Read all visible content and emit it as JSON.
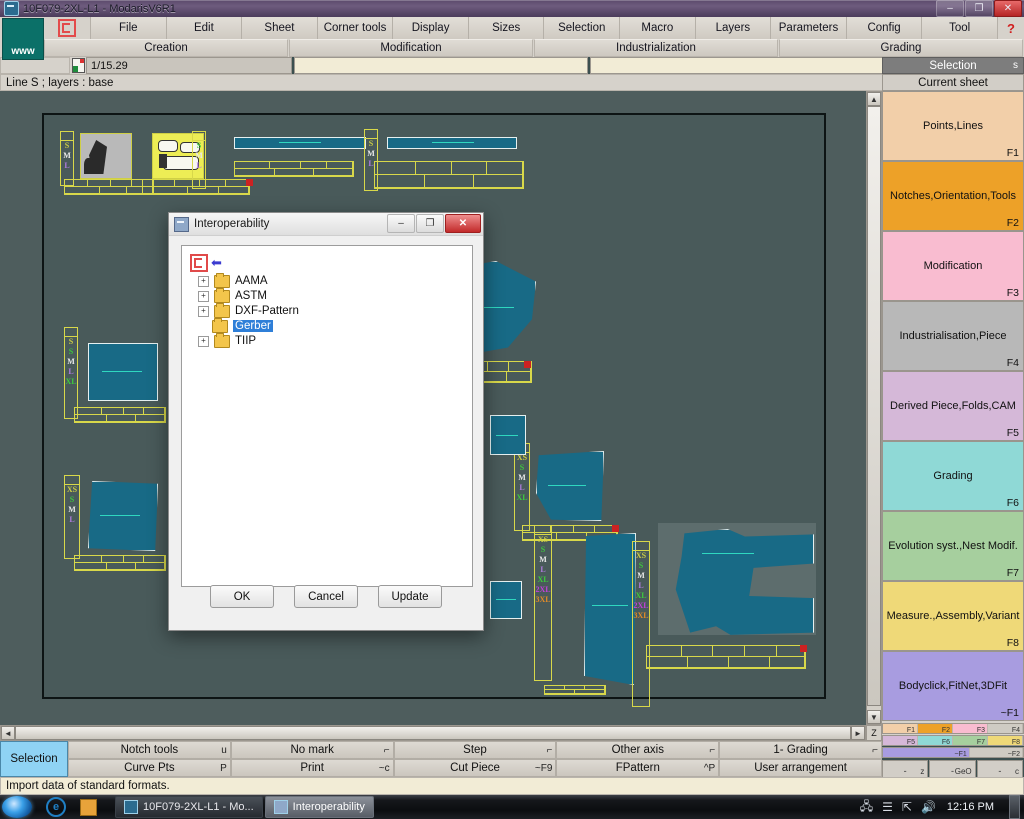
{
  "window": {
    "title": "10F079-2XL-L1 - ModarisV6R1",
    "minimize": "–",
    "maximize": "❐",
    "close": "✕"
  },
  "menubar": {
    "logo_icon": "modaris-logo-icon",
    "www_label": "www",
    "items": [
      "File",
      "Edit",
      "Sheet",
      "Corner tools",
      "Display",
      "Sizes",
      "Selection",
      "Macro",
      "Layers",
      "Parameters",
      "Config",
      "Tool"
    ],
    "help_label": "?"
  },
  "submenubar": {
    "items": [
      "Creation",
      "Modification",
      "Industrialization",
      "Grading"
    ]
  },
  "fieldrow": {
    "sheet_icon": "sheet-icon",
    "scale_value": "1/15.29",
    "input2_value": "",
    "input3_value": "",
    "selection_label": "Selection",
    "selection_key": "s"
  },
  "layerline": {
    "text": "Line S   ;   layers : base",
    "current_sheet": "Current sheet"
  },
  "right_panel": {
    "fkeys": [
      {
        "label": "Points,Lines",
        "key": "F1",
        "color": "#f2cfa9"
      },
      {
        "label": "Notches,Orientation,Tools",
        "key": "F2",
        "color": "#eda128"
      },
      {
        "label": "Modification",
        "key": "F3",
        "color": "#f9bcd0"
      },
      {
        "label": "Industrialisation,Piece",
        "key": "F4",
        "color": "#b8b8b8"
      },
      {
        "label": "Derived Piece,Folds,CAM",
        "key": "F5",
        "color": "#d5b8d8"
      },
      {
        "label": "Grading",
        "key": "F6",
        "color": "#8fd9d6"
      },
      {
        "label": "Evolution syst.,Nest Modif.",
        "key": "F7",
        "color": "#a6cf9e"
      },
      {
        "label": "Measure.,Assembly,Variant",
        "key": "F8",
        "color": "#efd978"
      },
      {
        "label": "Bodyclick,FitNet,3DFit",
        "key": "~F1",
        "color": "#a89ce0"
      }
    ],
    "legend_row1": [
      {
        "key": "F1",
        "color": "#f2cfa9"
      },
      {
        "key": "F2",
        "color": "#eda128"
      },
      {
        "key": "F3",
        "color": "#f9bcd0"
      },
      {
        "key": "F4",
        "color": "#cfcbc3"
      }
    ],
    "legend_row2": [
      {
        "key": "F5",
        "color": "#d5b8d8"
      },
      {
        "key": "F6",
        "color": "#8fd9d6"
      },
      {
        "key": "F7",
        "color": "#a6cf9e"
      },
      {
        "key": "F8",
        "color": "#efd978"
      }
    ],
    "legend_row3": [
      {
        "key": "~F1",
        "color": "#a89ce0"
      },
      {
        "key": "~F2",
        "color": "#cfcbc3"
      }
    ],
    "bottom_cells": [
      {
        "label": "-",
        "accel": "z"
      },
      {
        "label": "-",
        "accel": "GeO"
      },
      {
        "label": "-",
        "accel": "c"
      }
    ]
  },
  "bottom_toolbar": {
    "selection_label": "Selection",
    "row1": [
      {
        "label": "Notch tools",
        "accel": "u"
      },
      {
        "label": "No mark",
        "accel": "⌐"
      },
      {
        "label": "Step",
        "accel": "⌐"
      },
      {
        "label": "Other axis",
        "accel": "⌐"
      },
      {
        "label": "1- Grading",
        "accel": "⌐"
      }
    ],
    "row2": [
      {
        "label": "Curve Pts",
        "accel": "P"
      },
      {
        "label": "Print",
        "accel": "~c"
      },
      {
        "label": "Cut Piece",
        "accel": "~F9"
      },
      {
        "label": "FPattern",
        "accel": "^P"
      },
      {
        "label": "User arrangement",
        "accel": ""
      }
    ]
  },
  "statusbar": {
    "text": "Import data of standard formats."
  },
  "dialog": {
    "title": "Interoperability",
    "icon": "interoperability-icon",
    "minimize": "–",
    "maximize": "❐",
    "close": "✕",
    "root_icon": "modaris-root-icon",
    "root_arrow": "⬅",
    "tree": [
      {
        "label": "AAMA",
        "expander": "+",
        "selected": false
      },
      {
        "label": "ASTM",
        "expander": "+",
        "selected": false
      },
      {
        "label": "DXF-Pattern",
        "expander": "+",
        "selected": false
      },
      {
        "label": "Gerber",
        "expander": "",
        "selected": true
      },
      {
        "label": "TIIP",
        "expander": "+",
        "selected": false
      }
    ],
    "buttons": [
      {
        "label": "OK"
      },
      {
        "label": "Cancel"
      },
      {
        "label": "Update"
      }
    ]
  },
  "scrollbars": {
    "up_arrow": "▲",
    "down_arrow": "▼",
    "left_arrow": "◄",
    "right_arrow": "►",
    "zoom_label": "Z"
  },
  "taskbar": {
    "start_icon": "windows-start-icon",
    "quick_launch": [
      "internet-explorer-icon",
      "folder-icon"
    ],
    "tasks": [
      {
        "label": "10F079-2XL-L1 - Mo...",
        "active": false
      },
      {
        "label": "Interoperability",
        "active": true
      }
    ],
    "tray_icons": [
      "network-icon",
      "list-icon",
      "shortcut-icon",
      "volume-icon"
    ],
    "clock": "12:16 PM"
  },
  "canvas": {
    "size_labels": [
      "XS",
      "S",
      "M",
      "L",
      "XL",
      "2XL",
      "3XL"
    ],
    "size_colors": [
      "#cfcf45",
      "#3ec93e",
      "#e8e8e8",
      "#b07ce0",
      "#3ec93e",
      "#c040d8",
      "#e08a28"
    ],
    "piece_fill": "#186a86",
    "piece_stroke": "#e6f0f0",
    "grid_stroke": "#d8d84a",
    "background": "#4e5d5d"
  }
}
